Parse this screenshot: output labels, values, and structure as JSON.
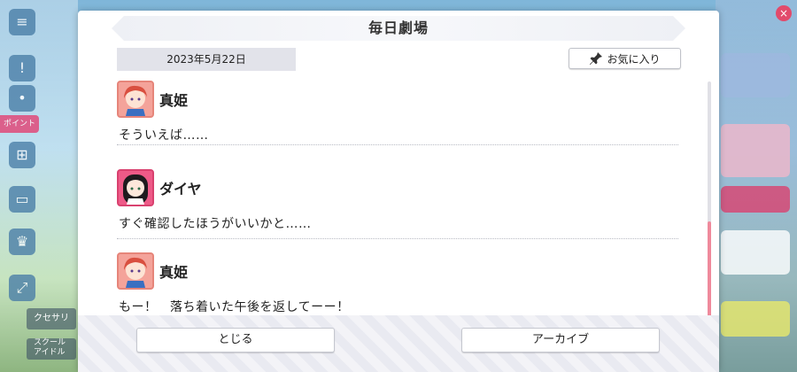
{
  "dialog": {
    "title": "毎日劇場",
    "date": "2023年5月22日",
    "favorite_label": "お気に入り",
    "close_label": "とじる",
    "archive_label": "アーカイブ"
  },
  "entries": [
    {
      "speaker": "真姫",
      "text": "そういえば……"
    },
    {
      "speaker": "ダイヤ",
      "text": "すぐ確認したほうがいいかと……"
    },
    {
      "speaker": "真姫",
      "text": "もー！　落ち着いた午後を返してーー！"
    }
  ],
  "background": {
    "left_tag": "ポイント",
    "left_labels": [
      "クセサリ",
      "スクール\nアイドル"
    ]
  },
  "scroll": {
    "position": 1.0
  },
  "colors": {
    "accent": "#ef8a9c",
    "maki": "#f4a39a",
    "dia": "#ee5a88"
  }
}
